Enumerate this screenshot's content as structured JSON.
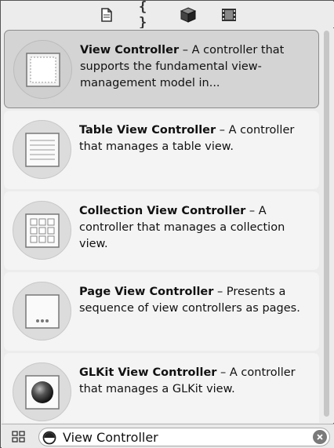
{
  "toolbar": {
    "icons": [
      "file-template-icon",
      "code-snippet-icon",
      "object-cube-icon",
      "media-film-icon"
    ],
    "code_snippet_glyph": "{ }"
  },
  "library": {
    "items": [
      {
        "title": "View Controller",
        "separator": " – ",
        "description": "A controller that supports the fundamental view-management model in...",
        "icon": "view-controller-icon",
        "selected": true
      },
      {
        "title": "Table View Controller",
        "separator": " – ",
        "description": "A controller that manages a table view.",
        "icon": "table-view-controller-icon",
        "selected": false
      },
      {
        "title": "Collection View Controller",
        "separator": " – ",
        "description": "A controller that manages a collection view.",
        "icon": "collection-view-controller-icon",
        "selected": false
      },
      {
        "title": "Page View Controller",
        "separator": " – ",
        "description": "Presents a sequence of view controllers as pages.",
        "icon": "page-view-controller-icon",
        "selected": false
      },
      {
        "title": "GLKit View Controller",
        "separator": " – ",
        "description": "A controller that manages a GLKit view.",
        "icon": "glkit-view-controller-icon",
        "selected": false
      }
    ]
  },
  "filter": {
    "value": "View Controller",
    "toggle_icon": "grid-view-icon",
    "filter_icon": "filter-circle-icon",
    "clear_icon": "clear-search-icon"
  },
  "colors": {
    "selected_row": "#d4d4d4",
    "row": "#f4f4f4",
    "panel": "#ececec"
  }
}
